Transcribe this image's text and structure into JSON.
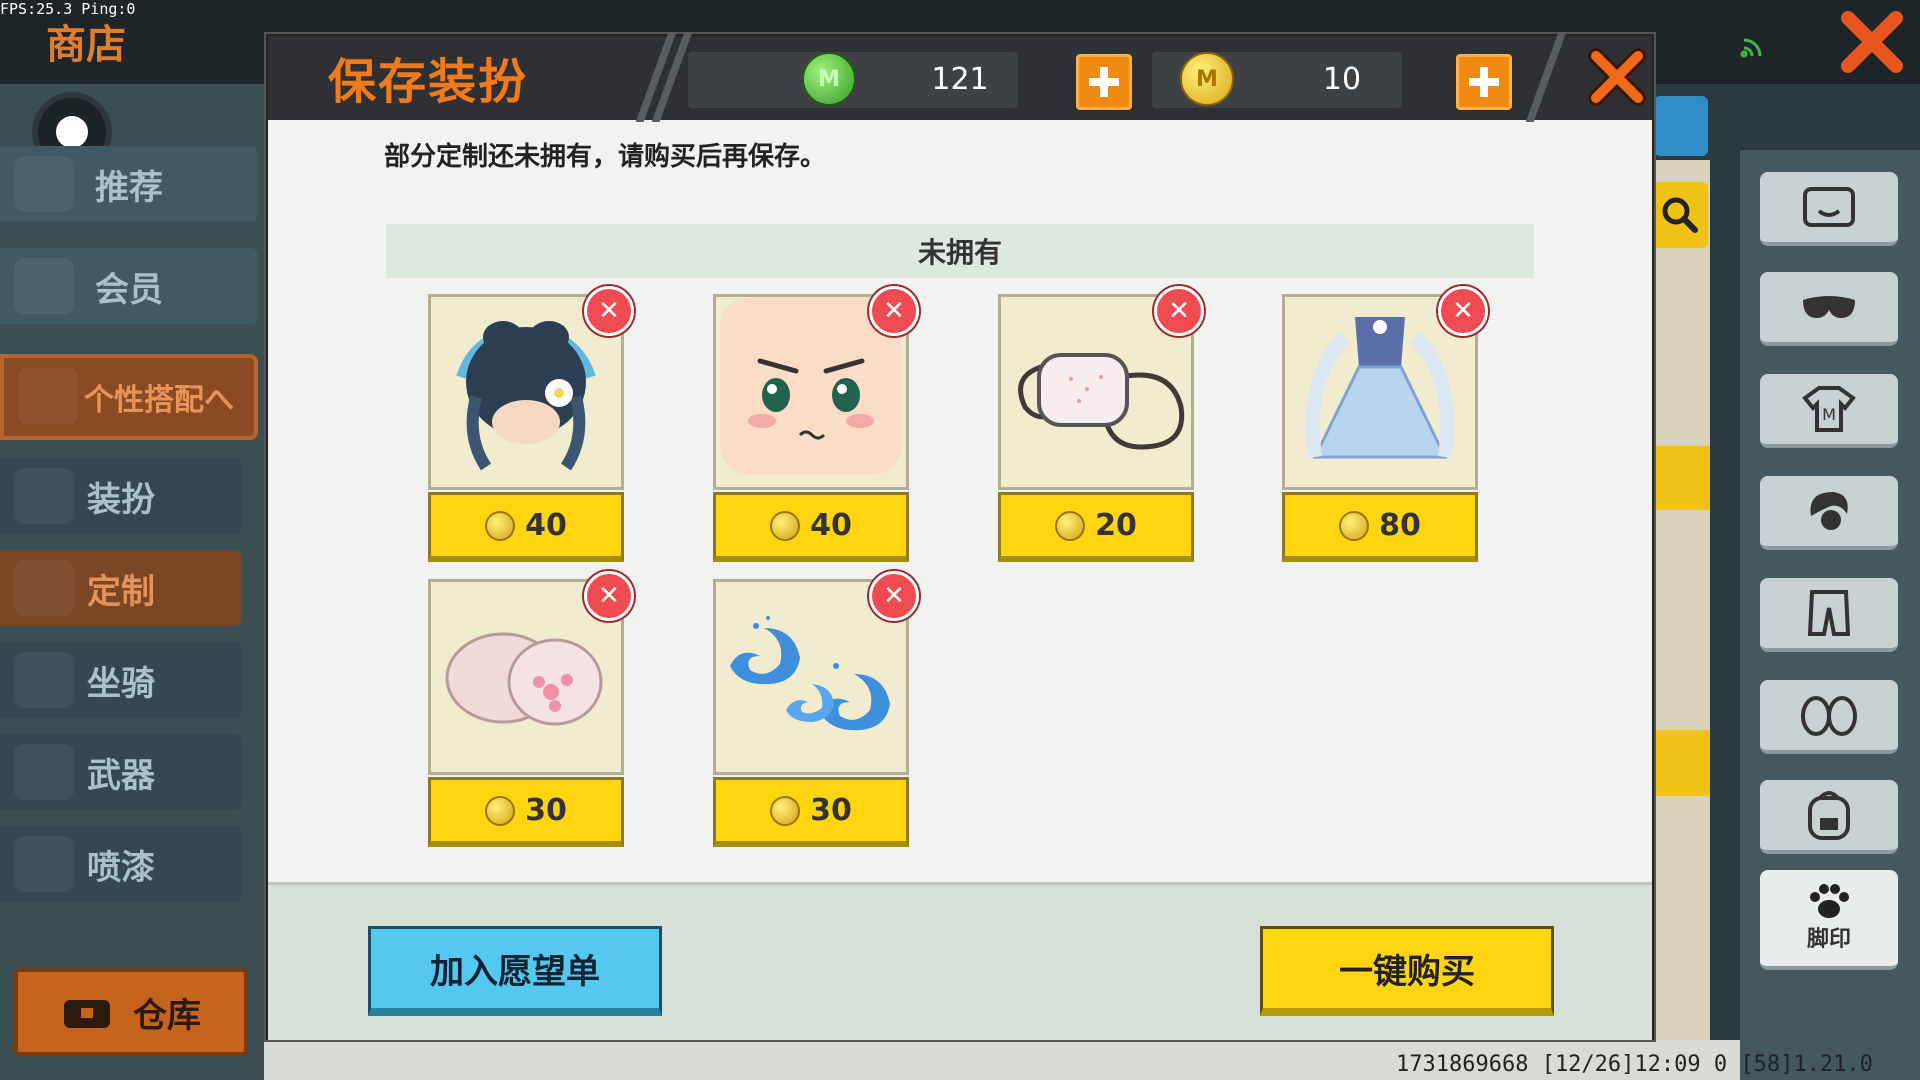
{
  "debug": {
    "fps_text": "FPS:25.3  Ping:0"
  },
  "shop": {
    "title": "商店",
    "sidebar": [
      {
        "label": "推荐"
      },
      {
        "label": "会员"
      },
      {
        "label": "个性搭配へ"
      },
      {
        "label": "装扮"
      },
      {
        "label": "定制"
      },
      {
        "label": "坐骑"
      },
      {
        "label": "武器"
      },
      {
        "label": "喷漆"
      }
    ],
    "warehouse_label": "仓库",
    "right_categories": [
      "face-icon",
      "mask-icon",
      "shirt-icon",
      "hair-icon",
      "pants-icon",
      "shoes-icon",
      "backpack-icon"
    ],
    "footprint_label": "脚印",
    "status_line": "1731869668   [12/26]12:09 0  [58]1.21.0"
  },
  "dialog": {
    "title": "保存装扮",
    "currency": {
      "green_coin_value": "121",
      "gold_coin_value": "10"
    },
    "notice": "部分定制还未拥有，请购买后再保存。",
    "section_label": "未拥有",
    "items": [
      {
        "name": "hair-bun-flower",
        "price": "40"
      },
      {
        "name": "face-expression",
        "price": "40"
      },
      {
        "name": "face-mask",
        "price": "20"
      },
      {
        "name": "blue-dress",
        "price": "80"
      },
      {
        "name": "cat-paw-gloves",
        "price": "30"
      },
      {
        "name": "wave-effect",
        "price": "30"
      }
    ],
    "wishlist_label": "加入愿望单",
    "buy_all_label": "一键购买"
  },
  "colors": {
    "title_orange": "#f07b1a",
    "price_yellow": "#ffd510",
    "wish_blue": "#54c8ee",
    "remove_red": "#f04a52"
  }
}
